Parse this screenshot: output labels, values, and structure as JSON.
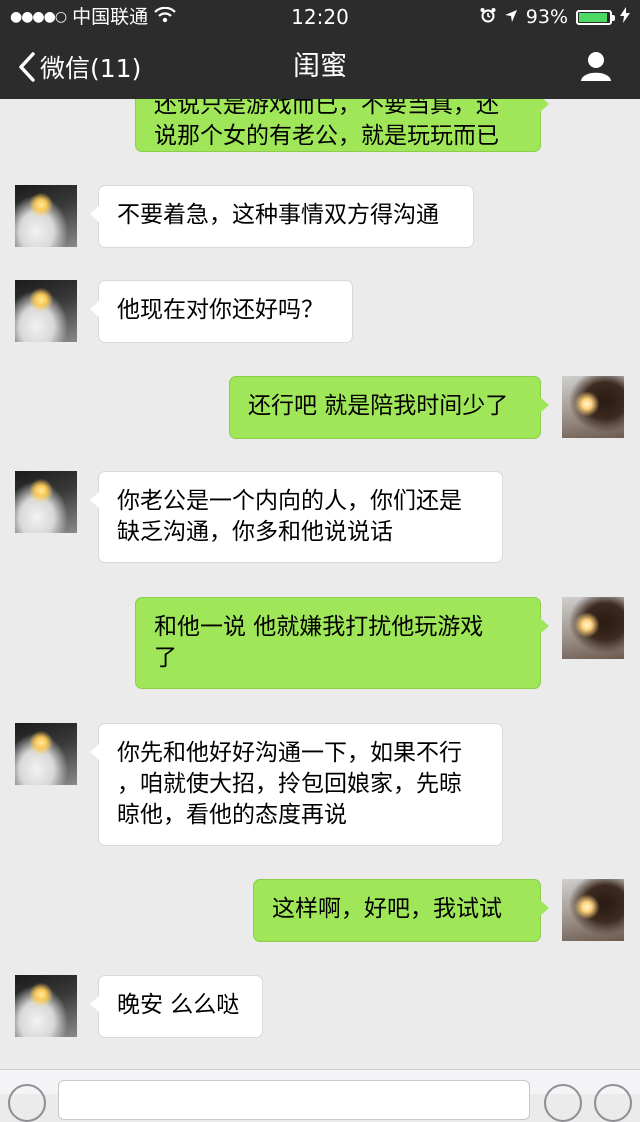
{
  "status_bar": {
    "signal_dots": "●●●●○",
    "carrier": "中国联通",
    "time": "12:20",
    "battery_percent": "93%",
    "battery_level": 0.93,
    "battery_color": "#4cd964"
  },
  "nav": {
    "back_label": "微信(11)",
    "title": "闺蜜"
  },
  "messages": [
    {
      "side": "right",
      "lines": [
        "还说只是游戏而已，不要当真，还",
        "说那个女的有老公，就是玩玩而已"
      ]
    },
    {
      "side": "left",
      "lines": [
        "不要着急，这种事情双方得沟通"
      ]
    },
    {
      "side": "left",
      "lines": [
        "他现在对你还好吗？"
      ]
    },
    {
      "side": "right",
      "lines": [
        "还行吧 就是陪我时间少了"
      ]
    },
    {
      "side": "left",
      "lines": [
        "你老公是一个内向的人，你们还是",
        "缺乏沟通，你多和他说说话"
      ]
    },
    {
      "side": "right",
      "lines": [
        "和他一说 他就嫌我打扰他玩游戏",
        "了"
      ]
    },
    {
      "side": "left",
      "lines": [
        "你先和他好好沟通一下，如果不行",
        "，咱就使大招，拎包回娘家，先晾",
        "晾他，看他的态度再说"
      ]
    },
    {
      "side": "right",
      "lines": [
        "这样啊，好吧，我试试"
      ]
    },
    {
      "side": "left",
      "lines": [
        "晚安 么么哒"
      ]
    }
  ],
  "colors": {
    "nav_bg": "#2c2c2c",
    "chat_bg": "#ebebeb",
    "bubble_mine": "#9fe658",
    "bubble_theirs": "#ffffff"
  },
  "icons": {
    "wifi": "wifi-icon",
    "alarm": "alarm-icon",
    "location": "location-arrow-icon",
    "charging": "charging-bolt-icon",
    "back": "chevron-left-icon",
    "profile": "person-icon"
  }
}
